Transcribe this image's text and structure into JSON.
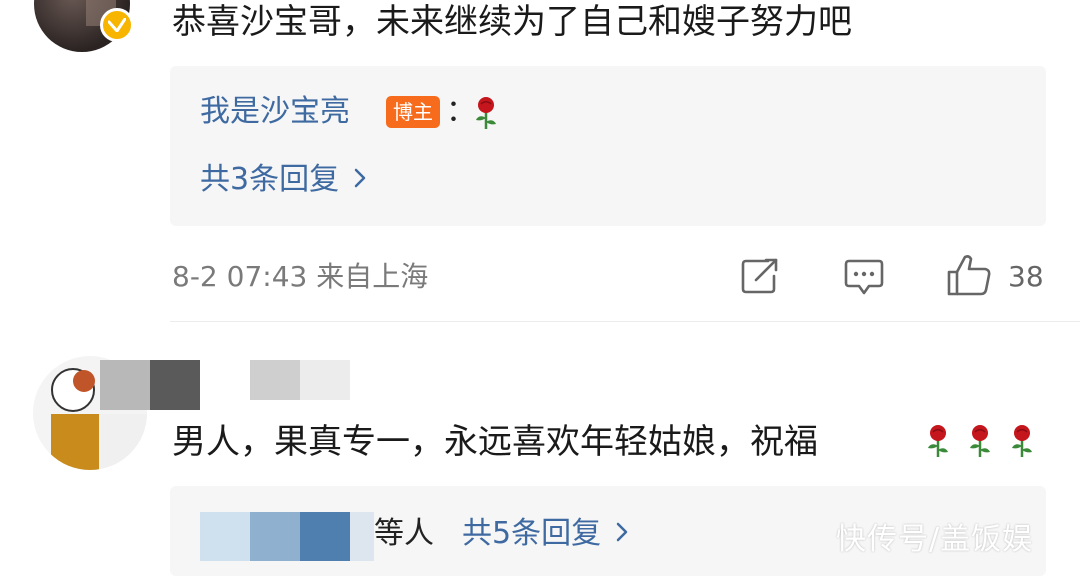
{
  "comment1": {
    "text": "恭喜沙宝哥，未来继续为了自己和嫂子努力吧",
    "reply": {
      "author": "我是沙宝亮",
      "badge": "博主",
      "colon": "：",
      "emoji_icon": "rose-icon",
      "count_label": "共3条回复"
    },
    "meta": "8-2 07:43 来自上海",
    "like_count": "38"
  },
  "comment2": {
    "text": "男人，果真专一，永远喜欢年轻姑娘，祝福",
    "emoji_icon": "rose-icon",
    "reply_others": "等人",
    "reply_count_label": "共5条回复"
  },
  "watermark": "快传号/盖饭娱",
  "colors": {
    "link_blue": "#3e6aa1",
    "badge_orange": "#f66c1c",
    "verified_gold": "#f7b500",
    "reply_bg": "#f6f6f6",
    "meta_gray": "#7a7a7a"
  }
}
